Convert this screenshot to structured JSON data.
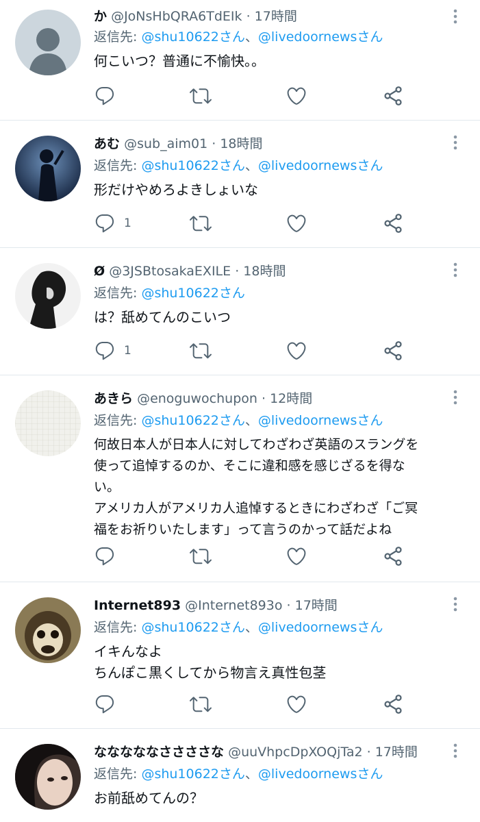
{
  "reply_prefix": "返信先: ",
  "separator": "、",
  "dot": "·",
  "tweets": [
    {
      "name": "か",
      "handle": "@JoNsHbQRA6TdEIk",
      "time": "17時間",
      "mentions": [
        "@shu10622さん",
        "@livedoornewsさん"
      ],
      "text": "何こいつ？普通に不愉快。。",
      "reply_count": ""
    },
    {
      "name": "あむ",
      "handle": "@sub_aim01",
      "time": "18時間",
      "mentions": [
        "@shu10622さん",
        "@livedoornewsさん"
      ],
      "text": "形だけやめろよきしょいな",
      "reply_count": "1"
    },
    {
      "name": "Ø",
      "handle": "@3JSBtosakaEXILE",
      "time": "18時間",
      "mentions": [
        "@shu10622さん"
      ],
      "text": "は？舐めてんのこいつ",
      "reply_count": "1"
    },
    {
      "name": "あきら",
      "handle": "@enoguwochupon",
      "time": "12時間",
      "mentions": [
        "@shu10622さん",
        "@livedoornewsさん"
      ],
      "text": "何故日本人が日本人に対してわざわざ英語のスラングを\n使って追悼するのか、そこに違和感を感じざるを得な\nい。\nアメリカ人がアメリカ人追悼するときにわざわざ「ご冥\n福をお祈りいたします」って言うのかって話だよね",
      "reply_count": ""
    },
    {
      "name": "Internet893",
      "handle": "@Internet893o",
      "time": "17時間",
      "mentions": [
        "@shu10622さん",
        "@livedoornewsさん"
      ],
      "text": "イキんなよ\nちんぽこ黒くしてから物言え真性包茎",
      "reply_count": ""
    },
    {
      "name": "なななななささささな",
      "handle": "@uuVhpcDpXOQjTa2",
      "time": "17時間",
      "mentions": [
        "@shu10622さん",
        "@livedoornewsさん"
      ],
      "text": "お前舐めてんの？",
      "reply_count": ""
    }
  ],
  "colors": {
    "text": "#0f1419",
    "secondary": "#536471",
    "link": "#1d9bf0",
    "icon": "#536471",
    "divider": "#e1e8ed"
  }
}
